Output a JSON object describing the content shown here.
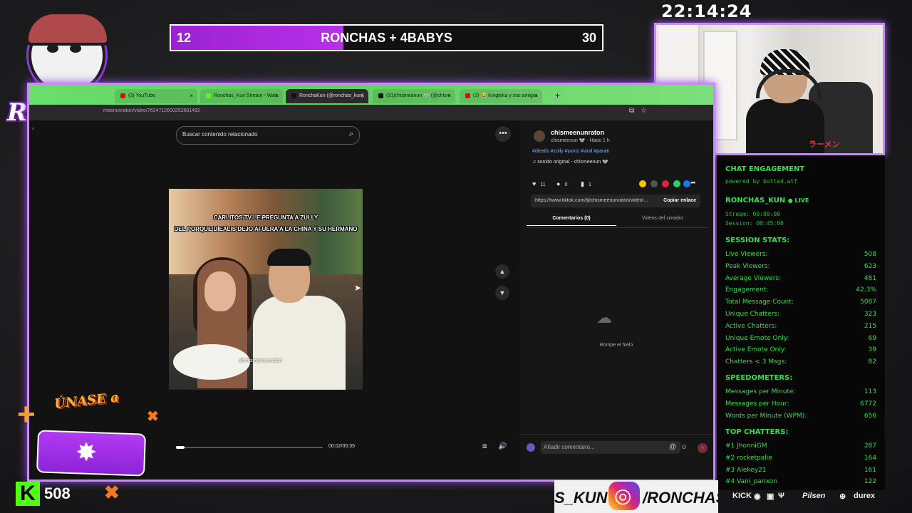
{
  "logo": {
    "text": "RONCHAS"
  },
  "scorebar": {
    "left_score": "12",
    "title": "RONCHAS + 4BABYS",
    "right_score": "30",
    "progress": 0.4
  },
  "clock": "22:14:24",
  "webcam": {
    "shirt_text": "ラーメン"
  },
  "browser": {
    "tabs": [
      {
        "label": "(3) YouTube",
        "icon": "youtube-icon",
        "color": "#ff0000"
      },
      {
        "label": "Ronchas_Kun Stream - Watch L...",
        "icon": "kick-icon",
        "color": "#53fc18"
      },
      {
        "label": "RonchaKun (@ronchas_kun) |...",
        "icon": "tiktok-icon",
        "color": "#111111"
      },
      {
        "label": "(31)chismeenun 🐭 (@chism...",
        "icon": "tiktok-icon",
        "color": "#111111"
      },
      {
        "label": "(3) 😂 Kingteka y sus amigos s...",
        "icon": "youtube-icon",
        "color": "#ff0000"
      }
    ],
    "new_tab": "+",
    "url": "meenunraton/video/7624712600252681492"
  },
  "tiktok": {
    "search_placeholder": "Buscar contenido relacionado",
    "caption_line1": "CARLITOS TV LE PREGUNTA A ZULLY",
    "caption_line2": "DEL PORQUE DIEALIS DEJO AFUERA A LA CHINA Y SU HERMANO",
    "watermark": "@chismeenunraton",
    "time": "00:02/00:35",
    "video_progress": 0.06,
    "username": "chismeenunraton",
    "user_sub": "chismeenun 🐭 · Hace 1 h",
    "tags": "#diealis #zully #yaniz #viral #parati",
    "sound": "sonido original - chismeenun 🐭",
    "likes": "11",
    "comments": "0",
    "saves": "1",
    "share_colors": [
      "#f5c400",
      "#555555",
      "#e6223b",
      "#25d366",
      "#1877f2"
    ],
    "link": "https://www.tiktok.com/@chismeenunraton/video/...",
    "copy_label": "Copiar enlace",
    "tab_comments": "Comentarios (0)",
    "tab_creator": "Videos del creador",
    "empty_text": "Rompe el hielo",
    "comment_placeholder": "Añadir comentario..."
  },
  "stats": {
    "title": "CHAT ENGAGEMENT",
    "powered": "powered by botted.wtf",
    "channel": "RONCHAS_KUN",
    "live": "● LIVE",
    "stream": "Stream: 00:00:00",
    "session": "Session: 00:45:06",
    "session_title": "SESSION STATS:",
    "session_rows": [
      {
        "label": "Live Viewers:",
        "value": "508"
      },
      {
        "label": "Peak Viewers:",
        "value": "623"
      },
      {
        "label": "Average Viewers:",
        "value": "481"
      },
      {
        "label": "Engagement:",
        "value": "42.3%"
      },
      {
        "label": "Total Message Count:",
        "value": "5087"
      },
      {
        "label": "Unique Chatters:",
        "value": "323"
      },
      {
        "label": "Active Chatters:",
        "value": "215"
      },
      {
        "label": "Unique Emote Only:",
        "value": "69"
      },
      {
        "label": "Active Emote Only:",
        "value": "39"
      },
      {
        "label": "Chatters < 3 Msgs:",
        "value": "82"
      }
    ],
    "speed_title": "SPEEDOMETERS:",
    "speed_rows": [
      {
        "label": "Messages per Minute:",
        "value": "113"
      },
      {
        "label": "Messages per Hour:",
        "value": "6772"
      },
      {
        "label": "Words per Minute (WPM):",
        "value": "656"
      }
    ],
    "top_title": "TOP CHATTERS:",
    "top_rows": [
      {
        "label": "#1 JhonniGM",
        "value": "287"
      },
      {
        "label": "#2 rocketpalie",
        "value": "164"
      },
      {
        "label": "#3 Alekey21",
        "value": "161"
      },
      {
        "label": "#4 Vani_panxon",
        "value": "122"
      }
    ]
  },
  "promo": {
    "text": "ÚNASE a"
  },
  "kick": {
    "viewers": "508"
  },
  "social": {
    "left": "S_KUN",
    "right": "/RONCHAS"
  },
  "sponsors": [
    "KICK",
    "Pilsen",
    "durex"
  ]
}
